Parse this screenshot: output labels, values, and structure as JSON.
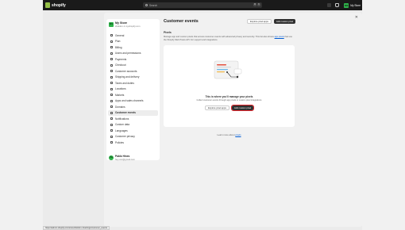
{
  "topbar": {
    "brand": "shopify",
    "search_placeholder": "Search",
    "shortcut_keys": [
      "⌘",
      "K"
    ],
    "store_initials": "MS",
    "store_label": "My Store"
  },
  "sidebar": {
    "store_name": "My Store",
    "store_url": "sheldon-1.myshopify.com",
    "items": [
      {
        "label": "General",
        "icon": "store-icon"
      },
      {
        "label": "Plan",
        "icon": "plan-icon"
      },
      {
        "label": "Billing",
        "icon": "billing-icon"
      },
      {
        "label": "Users and permissions",
        "icon": "users-icon"
      },
      {
        "label": "Payments",
        "icon": "payments-icon"
      },
      {
        "label": "Checkout",
        "icon": "checkout-icon"
      },
      {
        "label": "Customer accounts",
        "icon": "customer-accounts-icon"
      },
      {
        "label": "Shipping and delivery",
        "icon": "shipping-icon"
      },
      {
        "label": "Taxes and duties",
        "icon": "taxes-icon"
      },
      {
        "label": "Locations",
        "icon": "locations-icon"
      },
      {
        "label": "Markets",
        "icon": "markets-icon"
      },
      {
        "label": "Apps and sales channels",
        "icon": "apps-icon"
      },
      {
        "label": "Domains",
        "icon": "domains-icon"
      },
      {
        "label": "Customer events",
        "icon": "customer-events-icon",
        "active": true
      },
      {
        "label": "Notifications",
        "icon": "notifications-icon"
      },
      {
        "label": "Custom data",
        "icon": "custom-data-icon"
      },
      {
        "label": "Languages",
        "icon": "languages-icon"
      },
      {
        "label": "Customer privacy",
        "icon": "privacy-icon"
      },
      {
        "label": "Policies",
        "icon": "policies-icon"
      }
    ],
    "user_initials": "PH",
    "user_name": "Pablo Hines",
    "user_email": "hey.uxc@gmail.com"
  },
  "main": {
    "title": "Customer events",
    "explore_btn": "Explore pixel apps",
    "add_btn": "Add custom pixel",
    "section_label": "Pixels",
    "desc_1": "Manage app and custom pixels that access customer events with advanced privacy and security. This list also shows ",
    "desc_link": "app pixels",
    "desc_2": " that use the Shopify Web Pixels API. For support and integrations",
    "empty_title": "This is where you'll manage your pixels",
    "empty_desc": "Collect customer events through app pixels or custom pixel integrations",
    "empty_explore_btn": "Explore pixel apps",
    "empty_add_btn": "Add custom pixel",
    "learn_prefix": "Learn more about ",
    "learn_link": "pixels"
  },
  "statusbar": {
    "url": "https://admin.shopify.com/store/sheldon-1/settings/customer_events"
  },
  "colors": {
    "brand_green": "#95bf47",
    "store_avatar": "#2fb34a",
    "highlight": "#e0242a",
    "link": "#005bd3"
  }
}
